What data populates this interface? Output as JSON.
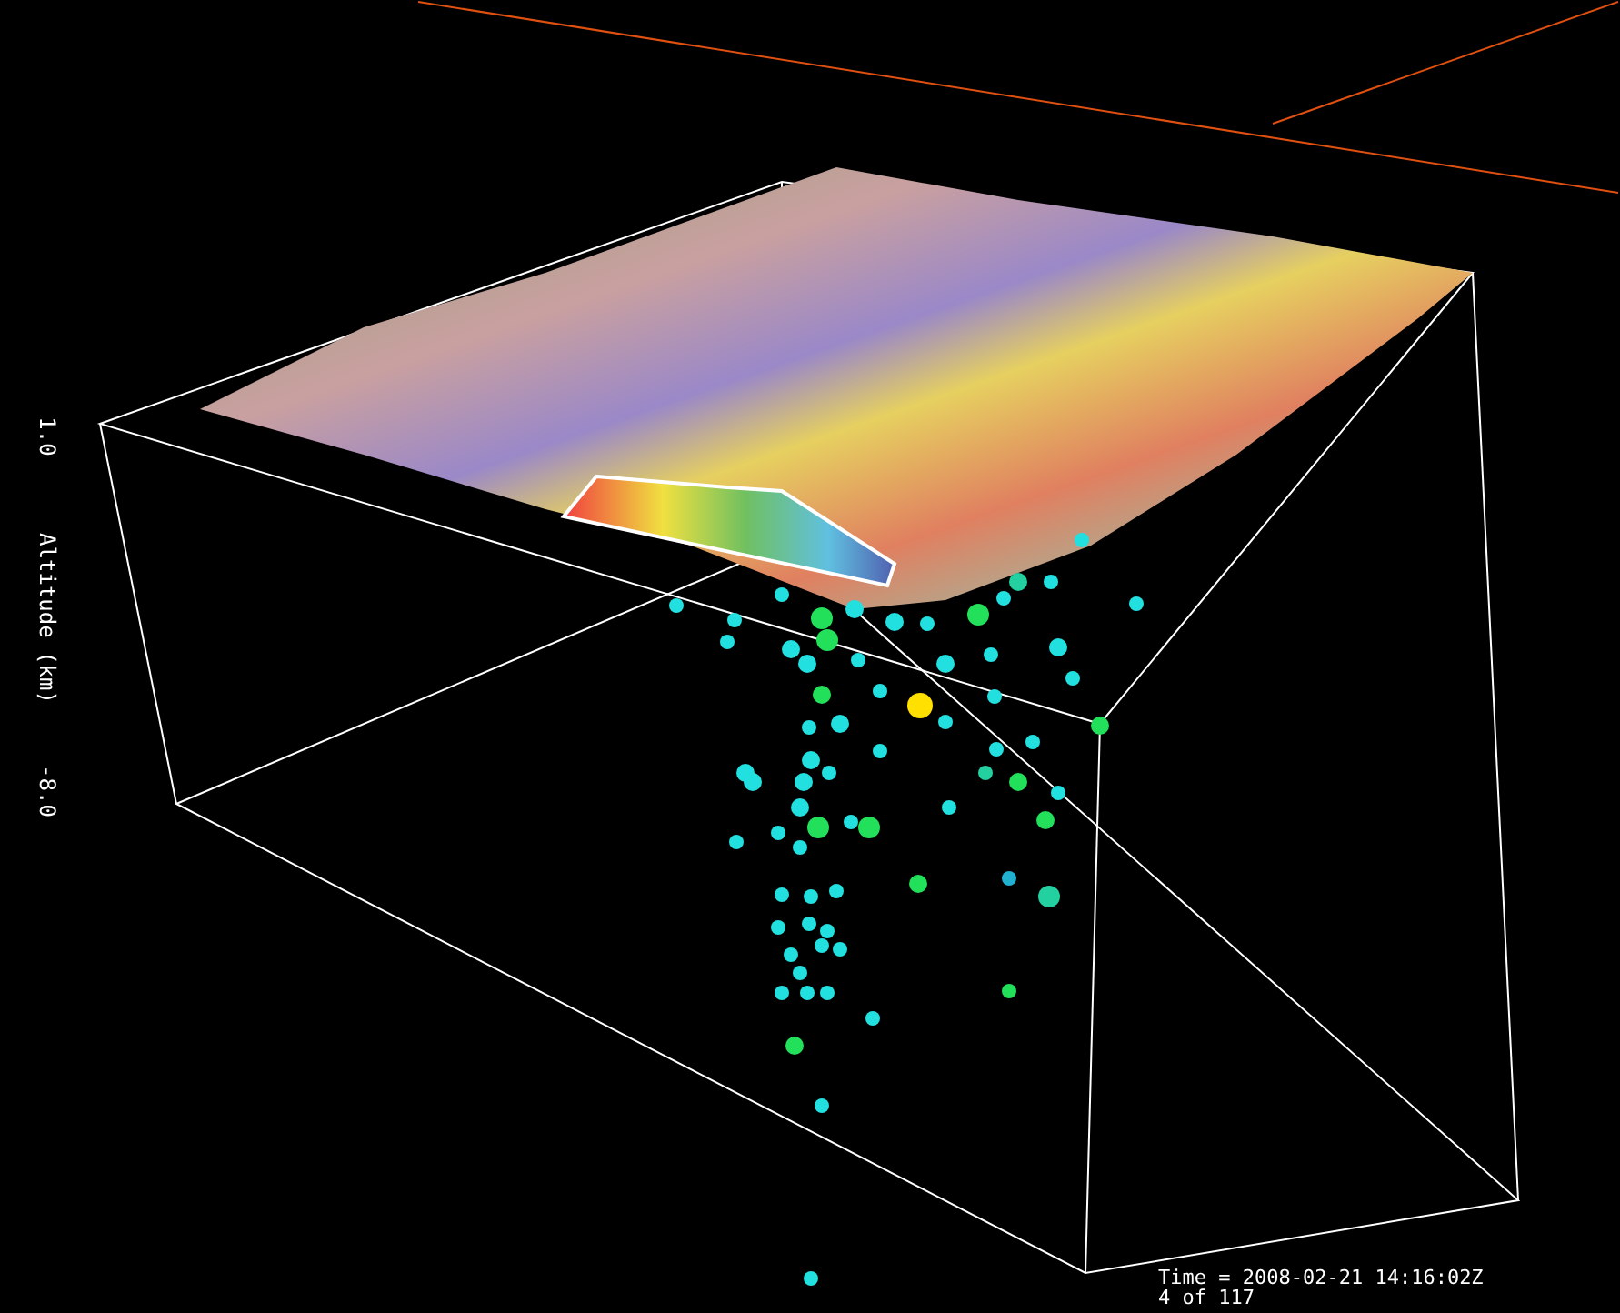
{
  "axis": {
    "label": "Altitude (km)",
    "ticks": [
      {
        "label": "1.0"
      },
      {
        "label": "-8.0"
      }
    ]
  },
  "status": {
    "time": "Time = 2008-02-21 14:16:02Z",
    "frame": "4 of 117"
  }
}
